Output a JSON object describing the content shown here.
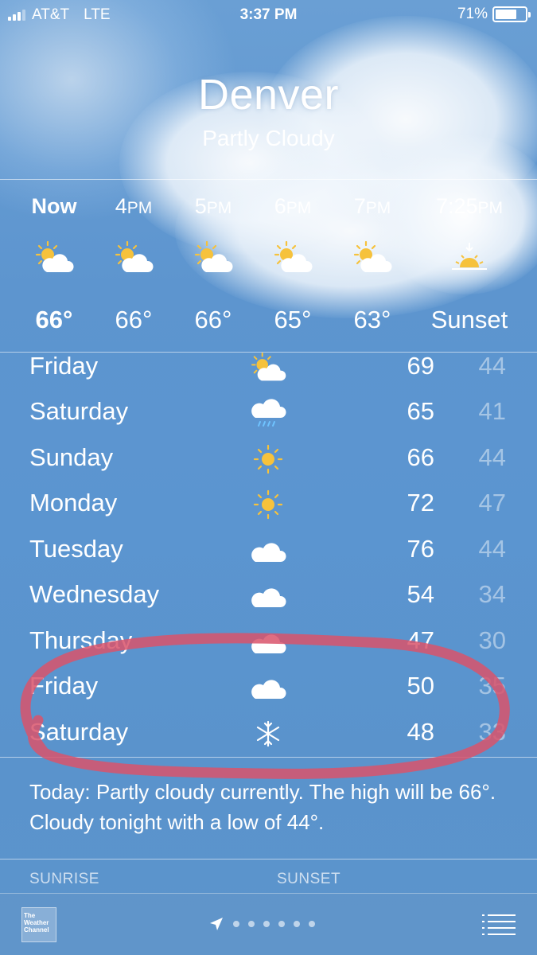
{
  "status": {
    "carrier": "AT&T",
    "network": "LTE",
    "time": "3:37 PM",
    "battery": "71%",
    "battery_level": 0.71
  },
  "location": {
    "city": "Denver",
    "condition": "Partly Cloudy"
  },
  "hourly": [
    {
      "label": "Now",
      "icon": "partly-cloudy-icon",
      "temp": "66°"
    },
    {
      "label": "4",
      "suffix": "PM",
      "icon": "partly-cloudy-icon",
      "temp": "66°"
    },
    {
      "label": "5",
      "suffix": "PM",
      "icon": "partly-cloudy-icon",
      "temp": "66°"
    },
    {
      "label": "6",
      "suffix": "PM",
      "icon": "partly-cloudy-icon",
      "temp": "65°"
    },
    {
      "label": "7",
      "suffix": "PM",
      "icon": "partly-cloudy-icon",
      "temp": "63°"
    },
    {
      "label": "7:25",
      "suffix": "PM",
      "icon": "sunset-icon",
      "temp": "Sunset"
    }
  ],
  "daily": [
    {
      "day": "Friday",
      "icon": "partly-cloudy-icon",
      "high": "69",
      "low": "44"
    },
    {
      "day": "Saturday",
      "icon": "rain-icon",
      "high": "65",
      "low": "41"
    },
    {
      "day": "Sunday",
      "icon": "sun-icon",
      "high": "66",
      "low": "44"
    },
    {
      "day": "Monday",
      "icon": "sun-icon",
      "high": "72",
      "low": "47"
    },
    {
      "day": "Tuesday",
      "icon": "cloud-icon",
      "high": "76",
      "low": "44"
    },
    {
      "day": "Wednesday",
      "icon": "cloud-icon",
      "high": "54",
      "low": "34"
    },
    {
      "day": "Thursday",
      "icon": "cloud-icon",
      "high": "47",
      "low": "30"
    },
    {
      "day": "Friday",
      "icon": "cloud-icon",
      "high": "50",
      "low": "35"
    },
    {
      "day": "Saturday",
      "icon": "snow-icon",
      "high": "48",
      "low": "33"
    }
  ],
  "summary": "Today: Partly cloudy currently. The high will be 66°. Cloudy tonight with a low of 44°.",
  "details": {
    "sunrise_label": "SUNRISE",
    "sunset_label": "SUNSET"
  },
  "bottom": {
    "logo_text": "The Weather Channel",
    "page_count": 6
  },
  "colors": {
    "background": "#5d95cf",
    "annotation": "#d9536b",
    "sun": "#f6c23c"
  }
}
